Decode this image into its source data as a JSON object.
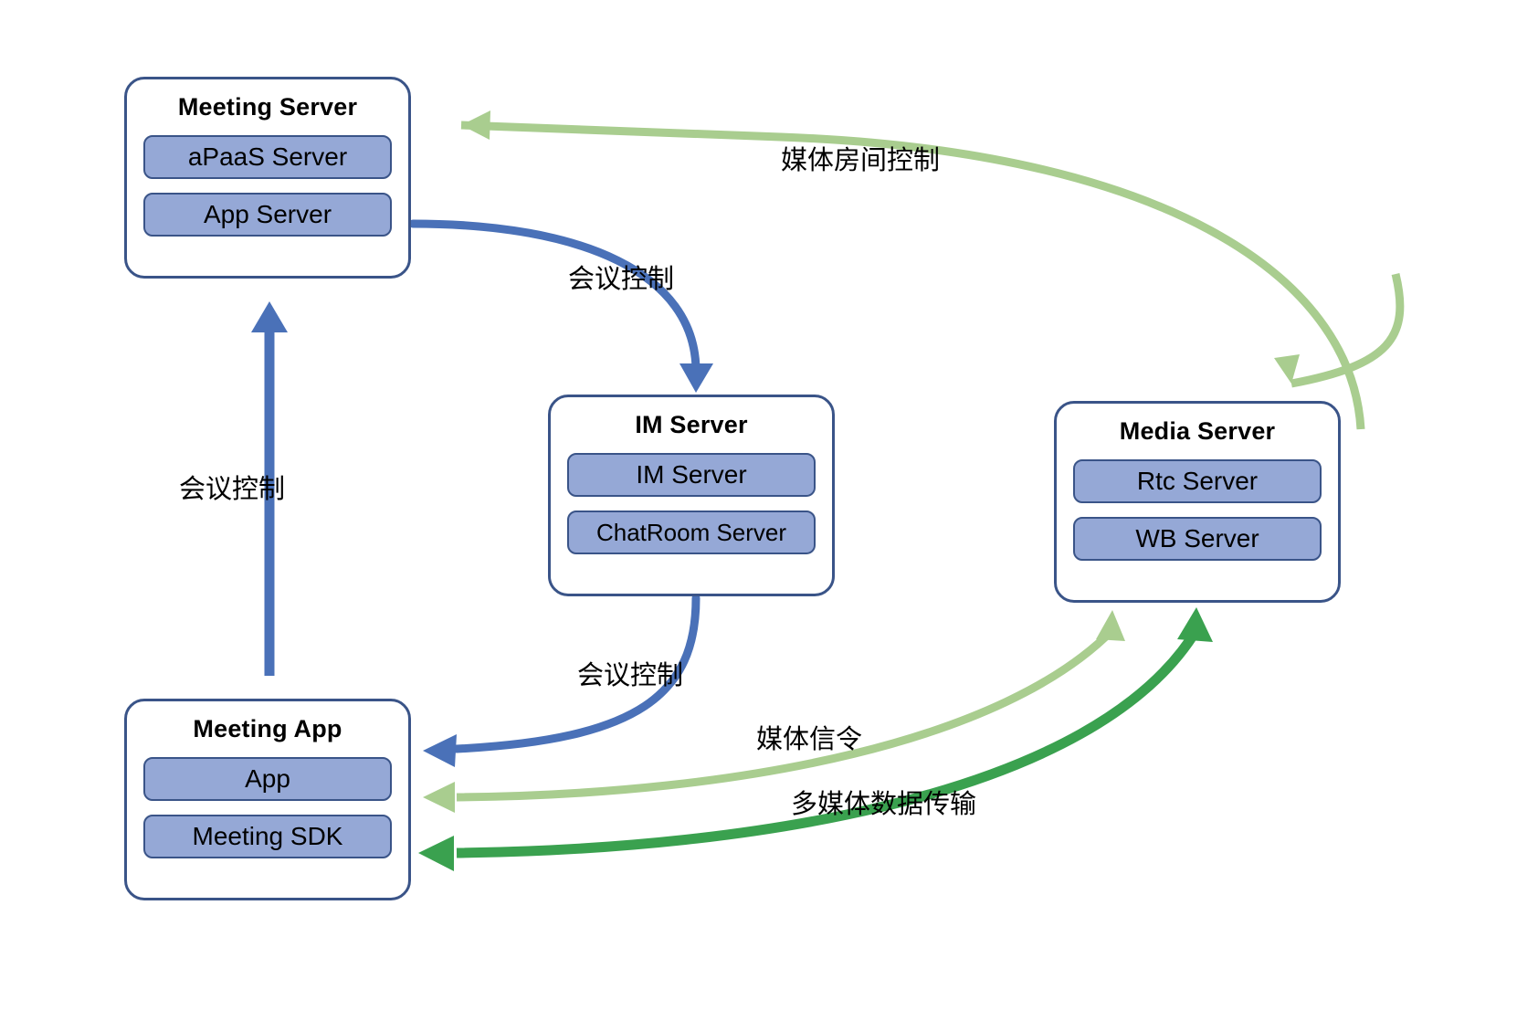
{
  "diagram": {
    "title": "Meeting architecture diagram",
    "colors": {
      "node_border": "#3a5488",
      "node_fill": "#ffffff",
      "sub_box_fill": "#95a8d6",
      "sub_box_border": "#3a5488",
      "arrow_blue": "#4a71b8",
      "arrow_light_green": "#a9cd8f",
      "arrow_green": "#3aa14f",
      "text": "#000000"
    },
    "nodes": [
      {
        "id": "meeting-server",
        "title": "Meeting Server",
        "items": [
          {
            "label": "aPaaS Server"
          },
          {
            "label": "App Server"
          }
        ]
      },
      {
        "id": "im-server",
        "title": "IM Server",
        "items": [
          {
            "label": "IM Server"
          },
          {
            "label": "ChatRoom Server"
          }
        ]
      },
      {
        "id": "media-server",
        "title": "Media Server",
        "items": [
          {
            "label": "Rtc Server"
          },
          {
            "label": "WB Server"
          }
        ]
      },
      {
        "id": "meeting-app",
        "title": "Meeting App",
        "items": [
          {
            "label": "App"
          },
          {
            "label": "Meeting SDK"
          }
        ]
      }
    ],
    "edges": [
      {
        "id": "media-room-control",
        "label": "媒体房间控制",
        "from": "media-server",
        "to": "meeting-server",
        "color": "#a9cd8f",
        "style": "curved-arrow"
      },
      {
        "id": "meeting-control-app-server-to-im",
        "label": "会议控制",
        "from": "meeting-server",
        "to": "im-server",
        "color": "#4a71b8",
        "style": "curved-arrow"
      },
      {
        "id": "meeting-control-app-to-meeting-server",
        "label": "会议控制",
        "from": "meeting-app",
        "to": "meeting-server",
        "color": "#4a71b8",
        "style": "straight-arrow"
      },
      {
        "id": "meeting-control-im-to-app",
        "label": "会议控制",
        "from": "im-server",
        "to": "meeting-app",
        "color": "#4a71b8",
        "style": "curved-arrow"
      },
      {
        "id": "media-signaling",
        "label": "媒体信令",
        "from": "meeting-app",
        "to": "media-server",
        "color": "#a9cd8f",
        "style": "double-curved-arrow"
      },
      {
        "id": "multimedia-data-transmission",
        "label": "多媒体数据传输",
        "from": "meeting-app",
        "to": "media-server",
        "color": "#3aa14f",
        "style": "double-curved-arrow"
      }
    ]
  }
}
